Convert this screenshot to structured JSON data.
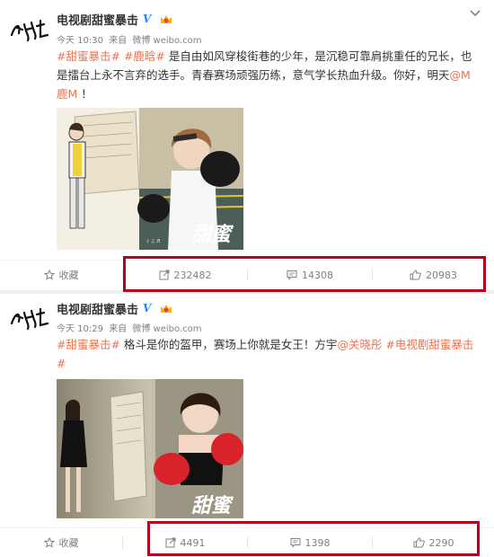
{
  "posts": [
    {
      "author": "电视剧甜蜜暴击",
      "time": "今天 10:30",
      "source_prefix": "来自",
      "source": "微博 weibo.com",
      "body": {
        "tag1": "#甜蜜暴击#",
        "tag2": "#鹿晗#",
        "text1": " 是自由如风穿梭街巷的少年，是沉稳可靠肩挑重任的兄长，也是擂台上永不言弃的选手。青春赛场顽强历练，意气学长热血升级。你好，明天",
        "mention": "@M鹿M",
        "text2": " ！"
      },
      "actions": {
        "favorite": "收藏",
        "repost": "232482",
        "comment": "14308",
        "like": "20983"
      }
    },
    {
      "author": "电视剧甜蜜暴击",
      "time": "今天 10:29",
      "source_prefix": "来自",
      "source": "微博 weibo.com",
      "body": {
        "tag1": "#甜蜜暴击#",
        "text1": " 格斗是你的盔甲，赛场上你就是女王！方宇",
        "mention": "@关晓彤",
        "tag2": " #电视剧甜蜜暴击#"
      },
      "actions": {
        "favorite": "收藏",
        "repost": "4491",
        "comment": "1398",
        "like": "2290"
      }
    }
  ],
  "colors": {
    "accent": "#eb7350",
    "highlight_box": "#b8001f",
    "verified": "#1a8cff"
  }
}
